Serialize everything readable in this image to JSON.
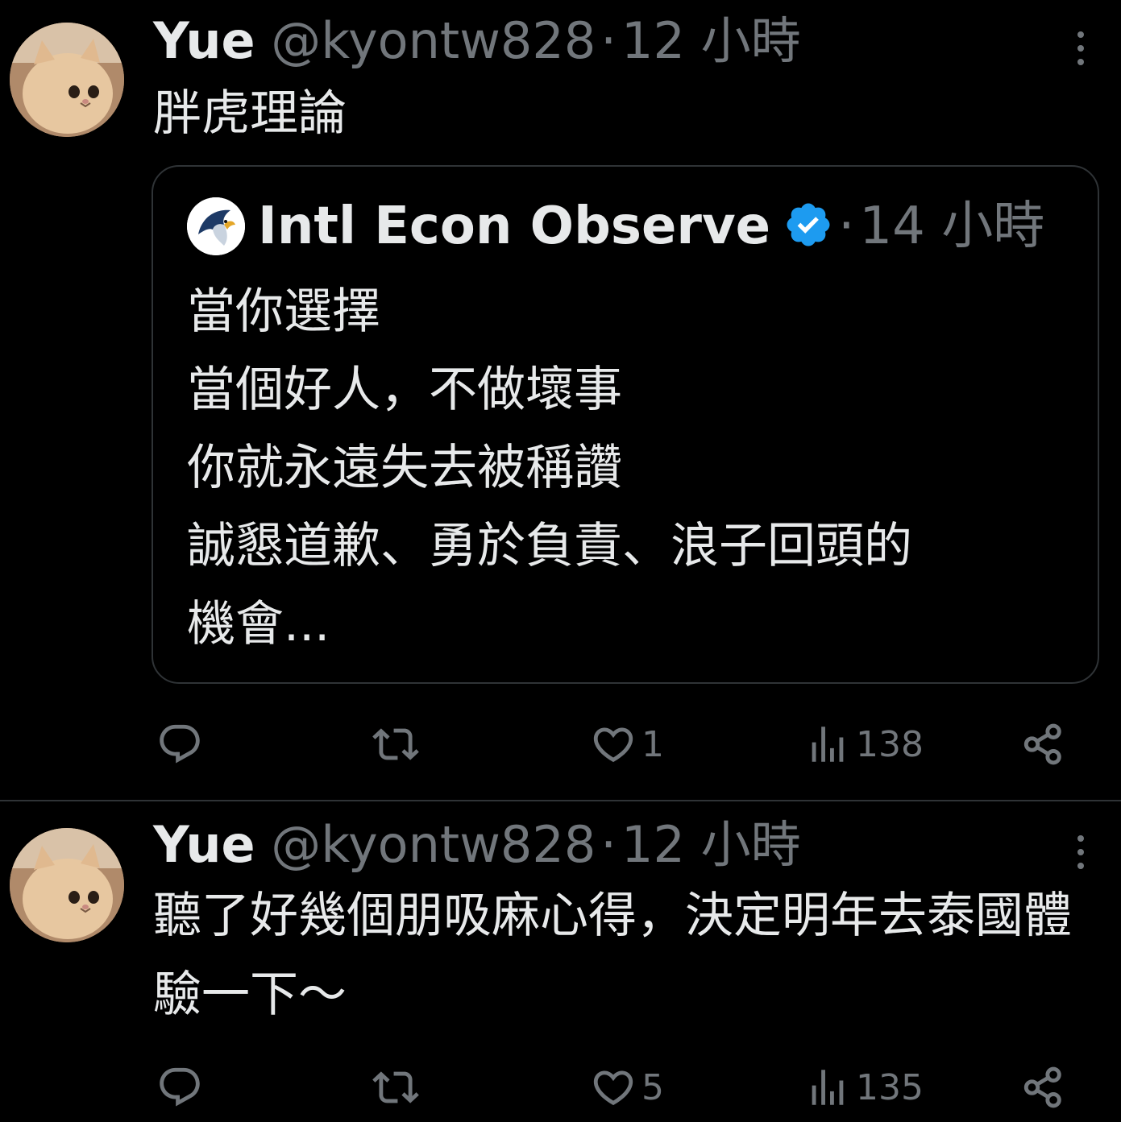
{
  "tweets": [
    {
      "display_name": "Yue",
      "handle": "@kyontw828",
      "separator": "·",
      "time": "12 小時",
      "text": "胖虎理論",
      "quote": {
        "display_name": "Intl Econ Observe",
        "separator": "·",
        "time": "14 小時",
        "lines": [
          "當你選擇",
          "當個好人，不做壞事",
          "你就永遠失去被稱讚",
          "誠懇道歉、勇於負責、浪子回頭的",
          "機會..."
        ]
      },
      "actions": {
        "reply_count": "",
        "retweet_count": "",
        "like_count": "1",
        "views_count": "138"
      }
    },
    {
      "display_name": "Yue",
      "handle": "@kyontw828",
      "separator": "·",
      "time": "12 小時",
      "text": "聽了好幾個朋吸麻心得，決定明年去泰國體驗一下～",
      "actions": {
        "reply_count": "",
        "retweet_count": "",
        "like_count": "5",
        "views_count": "135"
      }
    }
  ],
  "icons": {
    "reply": "reply-icon",
    "retweet": "retweet-icon",
    "like": "heart-icon",
    "views": "views-icon",
    "share": "share-icon",
    "more": "more-options-icon",
    "verified": "verified-badge-icon"
  },
  "colors": {
    "background": "#000000",
    "text_primary": "#e7e9ea",
    "text_secondary": "#71767b",
    "border": "#2f3336",
    "verified": "#1d9bf0"
  }
}
